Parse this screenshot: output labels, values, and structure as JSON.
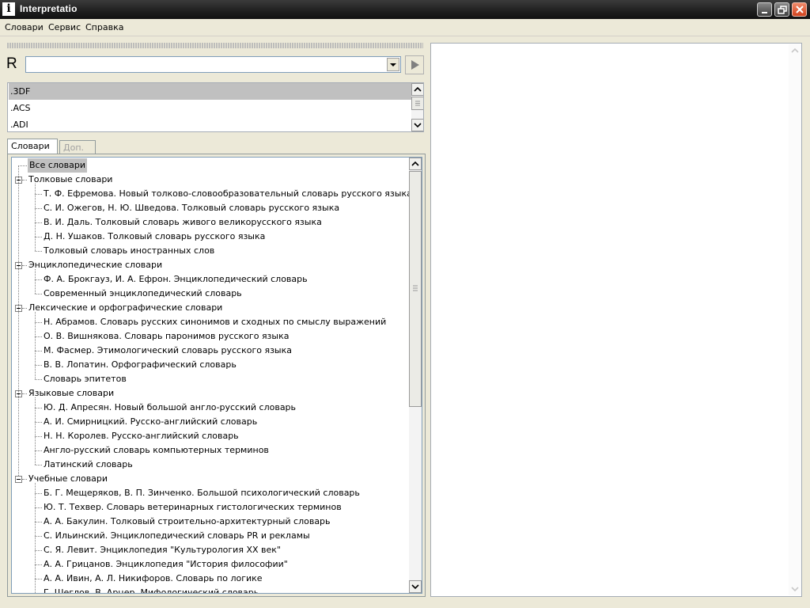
{
  "window": {
    "title": "Interpretatio",
    "app_icon": "i"
  },
  "menu": [
    "Словари",
    "Сервис",
    "Справка"
  ],
  "search": {
    "language": "R",
    "value": ""
  },
  "word_list": [
    ".3DF",
    ".ACS",
    ".ADI"
  ],
  "tabs": [
    "Словари",
    "Доп."
  ],
  "tree": {
    "all": "Все словари",
    "groups": [
      {
        "name": "Толковые словари",
        "items": [
          "Т. Ф. Ефремова. Новый толково-словообразовательный словарь русского языка",
          "С. И. Ожегов, Н. Ю. Шведова. Толковый словарь русского языка",
          "В. И. Даль. Толковый словарь живого великорусского языка",
          "Д. Н. Ушаков. Толковый словарь русского языка",
          "Толковый словарь иностранных слов"
        ]
      },
      {
        "name": "Энциклопедические словари",
        "items": [
          "Ф. А. Брокгауз, И. А. Ефрон. Энциклопедический словарь",
          "Современный энциклопедический словарь"
        ]
      },
      {
        "name": "Лексические и орфографические словари",
        "items": [
          "Н. Абрамов. Словарь русских синонимов и сходных по смыслу выражений",
          "О. В. Вишнякова. Словарь паронимов русского языка",
          "М. Фасмер. Этимологический словарь русского языка",
          "В. В. Лопатин. Орфографический словарь",
          "Словарь эпитетов"
        ]
      },
      {
        "name": "Языковые словари",
        "items": [
          "Ю. Д. Апресян. Новый большой англо-русский словарь",
          "А. И. Смирницкий. Русско-английский словарь",
          "Н. Н. Королев. Русско-английский словарь",
          "Англо-русский словарь компьютерных терминов",
          "Латинский словарь"
        ]
      },
      {
        "name": "Учебные словари",
        "items": [
          "Б. Г. Мещеряков, В. П. Зинченко. Большой психологический словарь",
          "Ю. Т. Техвер. Словарь ветеринарных гистологических терминов",
          "А. А. Бакулин. Толковый строительно-архитектурный словарь",
          "С. Ильинский. Энциклопедический словарь PR и рекламы",
          "С. Я. Левит. Энциклопедия \"Культурология XX век\"",
          "А. А. Грицанов. Энциклопедия \"История философии\"",
          "А. А. Ивин, А. Л. Никифоров. Словарь по логике",
          "Г. Шеглов, В. Арцер. Мифологический словарь"
        ]
      }
    ]
  },
  "colors": {
    "selection": "#c0c0c0",
    "window_bg": "#ece9d8",
    "close_button": "#d1441f"
  }
}
